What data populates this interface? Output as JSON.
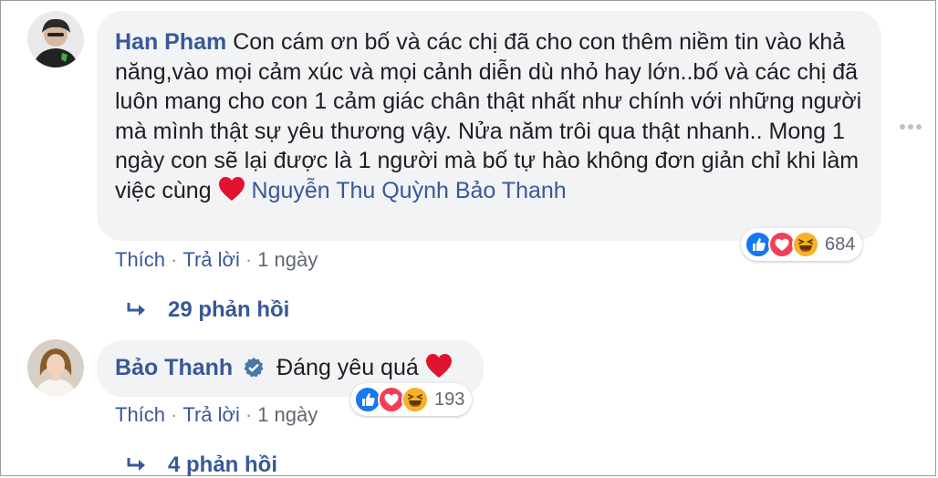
{
  "comments": [
    {
      "author": "Han Pham",
      "text": "Con cám ơn bố và các chị đã cho con thêm niềm tin vào khả năng,vào mọi cảm xúc và mọi cảnh diễn dù nhỏ hay lớn..bố và các chị đã luôn mang cho con 1 cảm giác chân thật nhất như chính với những người mà mình thật sự yêu thương vậy. Nửa năm trôi qua thật nhanh.. Mong 1 ngày con sẽ lại được là 1 người mà bố tự hào không đơn giản chỉ khi làm việc cùng",
      "text_emoji": "heart-emoji",
      "mention": "Nguyễn Thu Quỳnh Bảo Thanh",
      "actions": {
        "like": "Thích",
        "reply": "Trả lời",
        "time": "1 ngày"
      },
      "reactions": {
        "icons": [
          "like-icon",
          "love-icon",
          "haha-icon"
        ],
        "count": "684"
      },
      "replies_label": "29 phản hồi"
    },
    {
      "author": "Bảo Thanh",
      "verified": true,
      "text": "Đáng yêu quá",
      "text_emoji": "heart-emoji",
      "actions": {
        "like": "Thích",
        "reply": "Trả lời",
        "time": "1 ngày"
      },
      "reactions": {
        "icons": [
          "like-icon",
          "love-icon",
          "haha-icon"
        ],
        "count": "193"
      },
      "replies_label": "4 phản hồi"
    }
  ],
  "colors": {
    "link": "#385898",
    "bubble": "#f2f3f5",
    "like": "#1877f2",
    "love": "#f33e58",
    "haha": "#f7b125"
  }
}
